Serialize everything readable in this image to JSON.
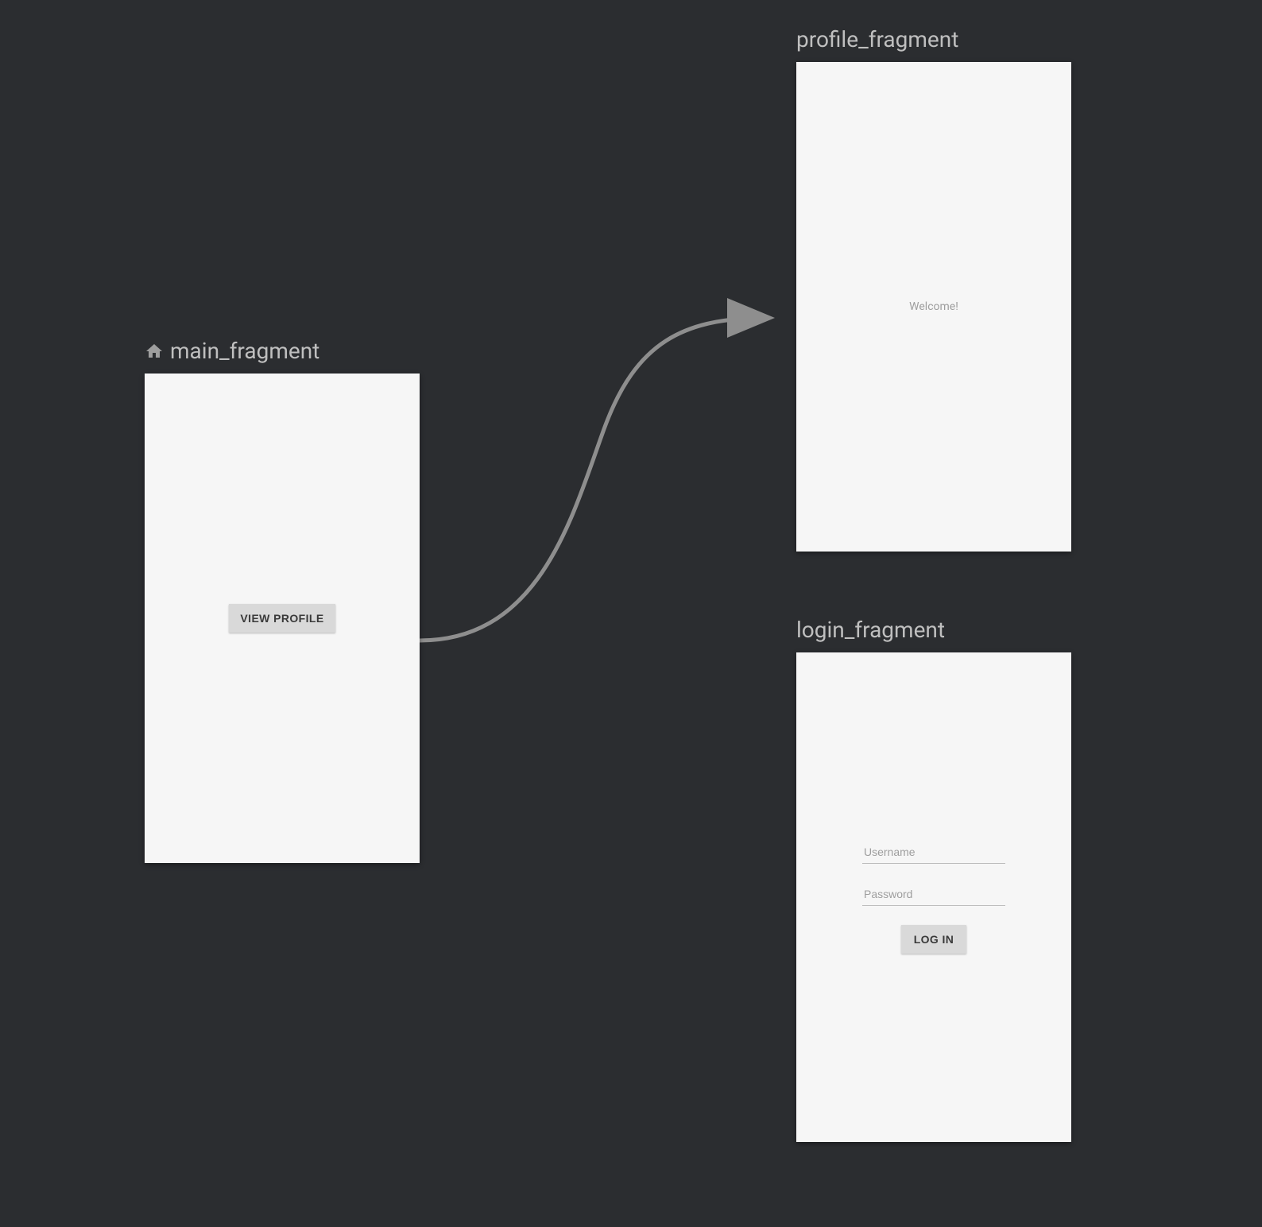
{
  "fragments": {
    "main": {
      "title": "main_fragment",
      "view_profile_button": "VIEW PROFILE"
    },
    "profile": {
      "title": "profile_fragment",
      "welcome_text": "Welcome!"
    },
    "login": {
      "title": "login_fragment",
      "username_placeholder": "Username",
      "password_placeholder": "Password",
      "login_button": "LOG IN"
    }
  }
}
